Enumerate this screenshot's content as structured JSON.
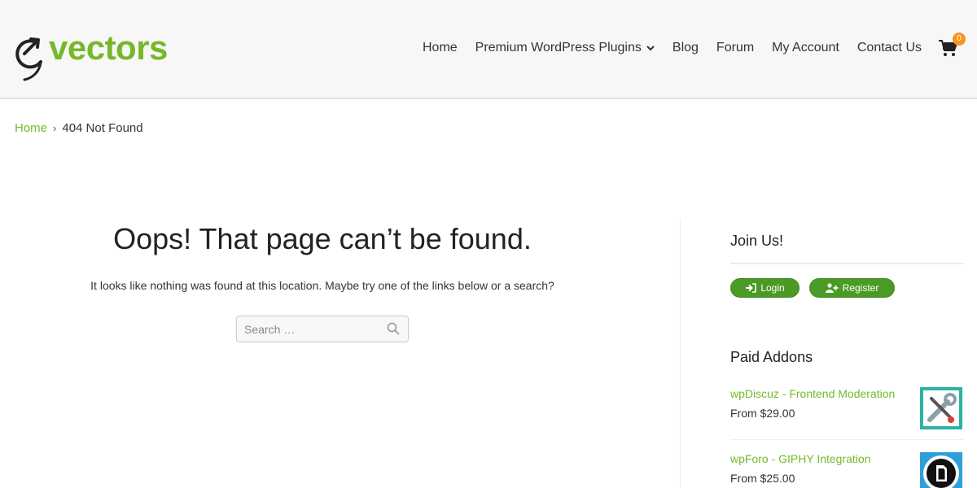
{
  "header": {
    "logo_text": "vectors",
    "nav": [
      {
        "label": "Home"
      },
      {
        "label": "Premium WordPress Plugins"
      },
      {
        "label": "Blog"
      },
      {
        "label": "Forum"
      },
      {
        "label": "My Account"
      },
      {
        "label": "Contact Us"
      }
    ],
    "cart_count": "0"
  },
  "breadcrumb": {
    "home": "Home",
    "separator": "›",
    "current": "404 Not Found"
  },
  "main": {
    "title": "Oops! That page can’t be found.",
    "message": "It looks like nothing was found at this location. Maybe try one of the links below or a search?",
    "search_placeholder": "Search …"
  },
  "sidebar": {
    "join_title": "Join Us!",
    "login_label": "Login",
    "register_label": "Register",
    "addons_title": "Paid Addons",
    "addons": [
      {
        "name": "wpDiscuz - Frontend Moderation",
        "price": "From $29.00"
      },
      {
        "name": "wpForo - GIPHY Integration",
        "price": "From $25.00"
      }
    ]
  },
  "colors": {
    "brand_green": "#76b82a",
    "button_green": "#4c9a26",
    "badge_orange": "#f7941d"
  }
}
